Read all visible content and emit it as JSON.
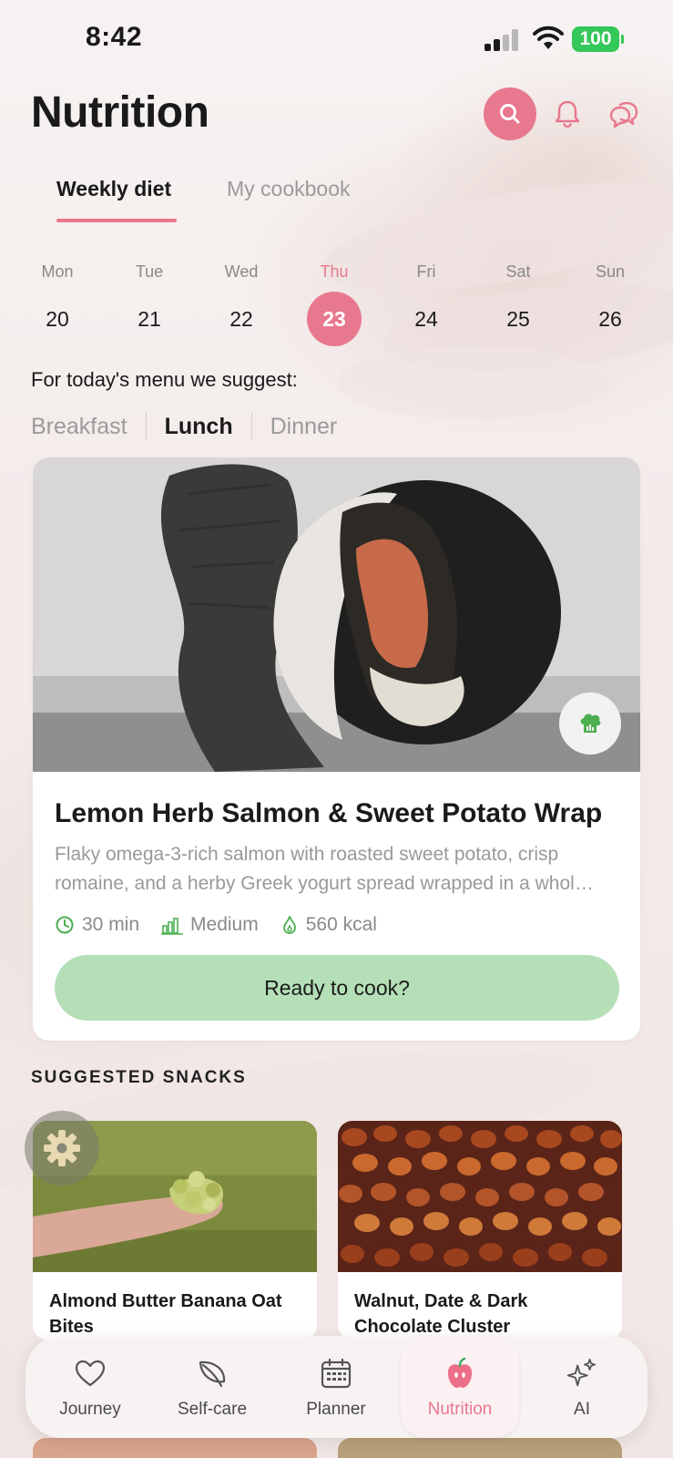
{
  "status_bar": {
    "time": "8:42",
    "battery": "100"
  },
  "header": {
    "title": "Nutrition",
    "icons": [
      "search-icon",
      "bell-icon",
      "chat-icon"
    ]
  },
  "tabs": [
    {
      "label": "Weekly diet",
      "active": true
    },
    {
      "label": "My cookbook",
      "active": false
    }
  ],
  "week": [
    {
      "day": "Mon",
      "date": "20"
    },
    {
      "day": "Tue",
      "date": "21"
    },
    {
      "day": "Wed",
      "date": "22"
    },
    {
      "day": "Thu",
      "date": "23",
      "active": true
    },
    {
      "day": "Fri",
      "date": "24"
    },
    {
      "day": "Sat",
      "date": "25"
    },
    {
      "day": "Sun",
      "date": "26"
    }
  ],
  "suggestion": {
    "label": "For today's menu we suggest:",
    "meals": [
      "Breakfast",
      "Lunch",
      "Dinner"
    ],
    "active_meal": "Lunch"
  },
  "recipe": {
    "title": "Lemon Herb Salmon & Sweet Potato Wrap",
    "description": "Flaky omega-3-rich salmon with roasted sweet potato, crisp romaine, and a herby Greek yogurt spread wrapped in a whol…",
    "time": "30 min",
    "difficulty": "Medium",
    "calories": "560 kcal",
    "cta": "Ready to cook?"
  },
  "snacks": {
    "header": "SUGGESTED SNACKS",
    "items": [
      {
        "title": "Almond Butter Banana Oat Bites"
      },
      {
        "title": "Walnut, Date & Dark Chocolate Cluster"
      }
    ]
  },
  "tab_bar": [
    {
      "label": "Journey",
      "icon": "heart-icon"
    },
    {
      "label": "Self-care",
      "icon": "leaf-icon"
    },
    {
      "label": "Planner",
      "icon": "calendar-icon"
    },
    {
      "label": "Nutrition",
      "icon": "apple-icon",
      "active": true
    },
    {
      "label": "AI",
      "icon": "sparkles-icon"
    }
  ],
  "colors": {
    "accent": "#e8788d",
    "cta": "#b5e0b7",
    "green_icon": "#4caf50"
  }
}
